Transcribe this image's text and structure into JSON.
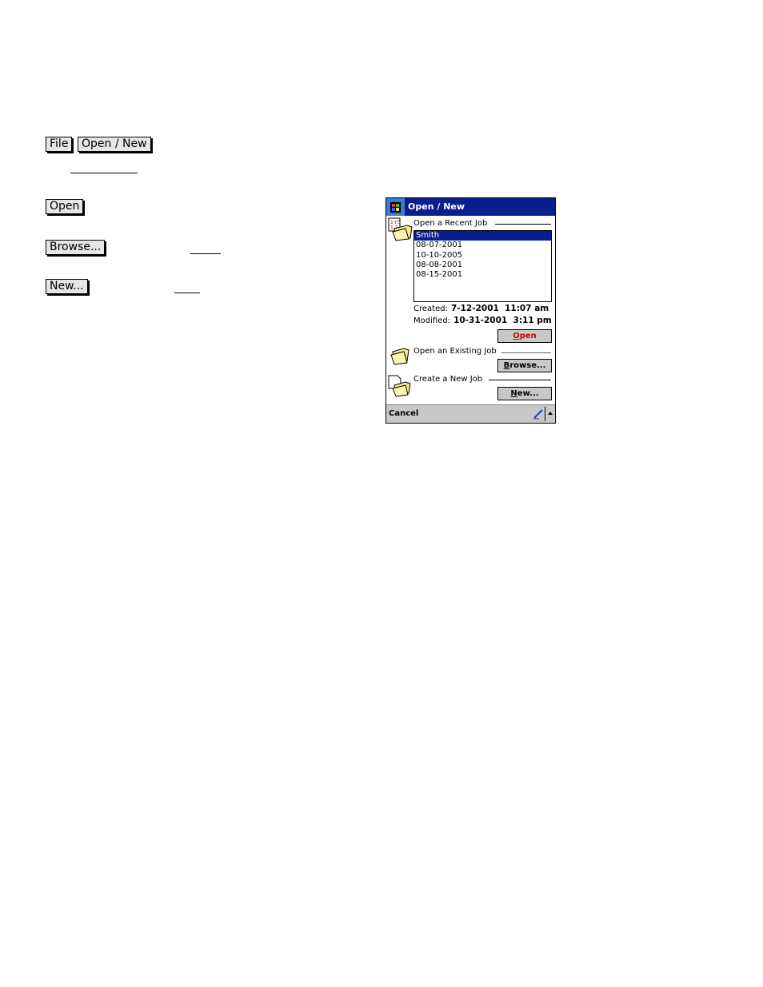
{
  "document": {
    "buttons": {
      "file": "File",
      "open_new": "Open / New",
      "open": "Open",
      "browse": "Browse...",
      "new": "New..."
    }
  },
  "pda": {
    "title": "Open / New",
    "recent": {
      "label": "Open a Recent Job",
      "items": [
        "Smith",
        "08-07-2001",
        "10-10-2005",
        "08-08-2001",
        "08-15-2001"
      ],
      "selected_index": 0
    },
    "created_label": "Created:",
    "created_value": "7-12-2001  11:07 am",
    "modified_label": "Modified:",
    "modified_value": "10-31-2001  3:11 pm",
    "open_button": {
      "accel": "O",
      "rest": "pen"
    },
    "existing": {
      "label": "Open an Existing Job"
    },
    "browse_button": {
      "accel": "B",
      "rest": "rowse..."
    },
    "create": {
      "label": "Create a New Job"
    },
    "new_button": {
      "accel": "N",
      "rest": "ew..."
    },
    "cancel_label": "Cancel",
    "colors": {
      "titlebar": "#0a1f8f",
      "open_text": "#cc0000",
      "selected": "#0a1f8f"
    }
  }
}
